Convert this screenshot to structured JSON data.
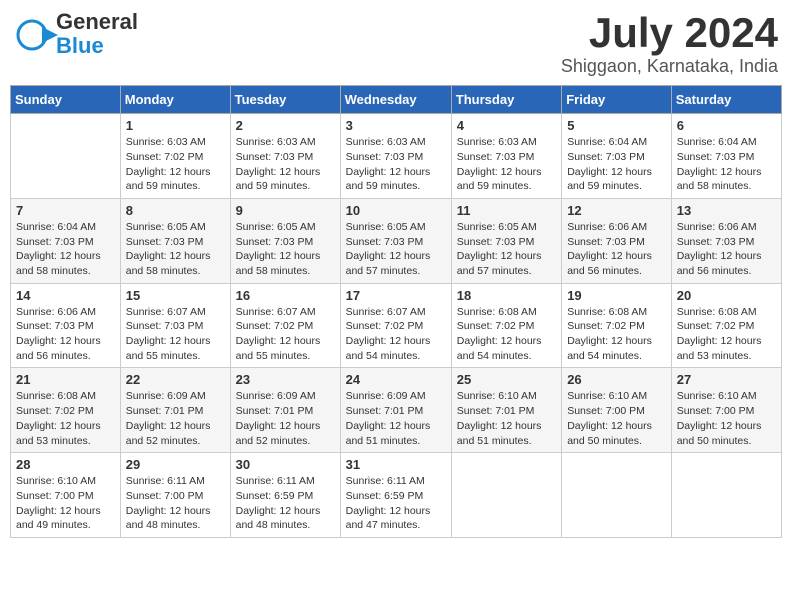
{
  "header": {
    "logo_line1": "General",
    "logo_line2": "Blue",
    "title": "July 2024",
    "subtitle": "Shiggaon, Karnataka, India"
  },
  "days_of_week": [
    "Sunday",
    "Monday",
    "Tuesday",
    "Wednesday",
    "Thursday",
    "Friday",
    "Saturday"
  ],
  "weeks": [
    [
      {
        "num": "",
        "info": ""
      },
      {
        "num": "1",
        "info": "Sunrise: 6:03 AM\nSunset: 7:02 PM\nDaylight: 12 hours\nand 59 minutes."
      },
      {
        "num": "2",
        "info": "Sunrise: 6:03 AM\nSunset: 7:03 PM\nDaylight: 12 hours\nand 59 minutes."
      },
      {
        "num": "3",
        "info": "Sunrise: 6:03 AM\nSunset: 7:03 PM\nDaylight: 12 hours\nand 59 minutes."
      },
      {
        "num": "4",
        "info": "Sunrise: 6:03 AM\nSunset: 7:03 PM\nDaylight: 12 hours\nand 59 minutes."
      },
      {
        "num": "5",
        "info": "Sunrise: 6:04 AM\nSunset: 7:03 PM\nDaylight: 12 hours\nand 59 minutes."
      },
      {
        "num": "6",
        "info": "Sunrise: 6:04 AM\nSunset: 7:03 PM\nDaylight: 12 hours\nand 58 minutes."
      }
    ],
    [
      {
        "num": "7",
        "info": "Sunrise: 6:04 AM\nSunset: 7:03 PM\nDaylight: 12 hours\nand 58 minutes."
      },
      {
        "num": "8",
        "info": "Sunrise: 6:05 AM\nSunset: 7:03 PM\nDaylight: 12 hours\nand 58 minutes."
      },
      {
        "num": "9",
        "info": "Sunrise: 6:05 AM\nSunset: 7:03 PM\nDaylight: 12 hours\nand 58 minutes."
      },
      {
        "num": "10",
        "info": "Sunrise: 6:05 AM\nSunset: 7:03 PM\nDaylight: 12 hours\nand 57 minutes."
      },
      {
        "num": "11",
        "info": "Sunrise: 6:05 AM\nSunset: 7:03 PM\nDaylight: 12 hours\nand 57 minutes."
      },
      {
        "num": "12",
        "info": "Sunrise: 6:06 AM\nSunset: 7:03 PM\nDaylight: 12 hours\nand 56 minutes."
      },
      {
        "num": "13",
        "info": "Sunrise: 6:06 AM\nSunset: 7:03 PM\nDaylight: 12 hours\nand 56 minutes."
      }
    ],
    [
      {
        "num": "14",
        "info": "Sunrise: 6:06 AM\nSunset: 7:03 PM\nDaylight: 12 hours\nand 56 minutes."
      },
      {
        "num": "15",
        "info": "Sunrise: 6:07 AM\nSunset: 7:03 PM\nDaylight: 12 hours\nand 55 minutes."
      },
      {
        "num": "16",
        "info": "Sunrise: 6:07 AM\nSunset: 7:02 PM\nDaylight: 12 hours\nand 55 minutes."
      },
      {
        "num": "17",
        "info": "Sunrise: 6:07 AM\nSunset: 7:02 PM\nDaylight: 12 hours\nand 54 minutes."
      },
      {
        "num": "18",
        "info": "Sunrise: 6:08 AM\nSunset: 7:02 PM\nDaylight: 12 hours\nand 54 minutes."
      },
      {
        "num": "19",
        "info": "Sunrise: 6:08 AM\nSunset: 7:02 PM\nDaylight: 12 hours\nand 54 minutes."
      },
      {
        "num": "20",
        "info": "Sunrise: 6:08 AM\nSunset: 7:02 PM\nDaylight: 12 hours\nand 53 minutes."
      }
    ],
    [
      {
        "num": "21",
        "info": "Sunrise: 6:08 AM\nSunset: 7:02 PM\nDaylight: 12 hours\nand 53 minutes."
      },
      {
        "num": "22",
        "info": "Sunrise: 6:09 AM\nSunset: 7:01 PM\nDaylight: 12 hours\nand 52 minutes."
      },
      {
        "num": "23",
        "info": "Sunrise: 6:09 AM\nSunset: 7:01 PM\nDaylight: 12 hours\nand 52 minutes."
      },
      {
        "num": "24",
        "info": "Sunrise: 6:09 AM\nSunset: 7:01 PM\nDaylight: 12 hours\nand 51 minutes."
      },
      {
        "num": "25",
        "info": "Sunrise: 6:10 AM\nSunset: 7:01 PM\nDaylight: 12 hours\nand 51 minutes."
      },
      {
        "num": "26",
        "info": "Sunrise: 6:10 AM\nSunset: 7:00 PM\nDaylight: 12 hours\nand 50 minutes."
      },
      {
        "num": "27",
        "info": "Sunrise: 6:10 AM\nSunset: 7:00 PM\nDaylight: 12 hours\nand 50 minutes."
      }
    ],
    [
      {
        "num": "28",
        "info": "Sunrise: 6:10 AM\nSunset: 7:00 PM\nDaylight: 12 hours\nand 49 minutes."
      },
      {
        "num": "29",
        "info": "Sunrise: 6:11 AM\nSunset: 7:00 PM\nDaylight: 12 hours\nand 48 minutes."
      },
      {
        "num": "30",
        "info": "Sunrise: 6:11 AM\nSunset: 6:59 PM\nDaylight: 12 hours\nand 48 minutes."
      },
      {
        "num": "31",
        "info": "Sunrise: 6:11 AM\nSunset: 6:59 PM\nDaylight: 12 hours\nand 47 minutes."
      },
      {
        "num": "",
        "info": ""
      },
      {
        "num": "",
        "info": ""
      },
      {
        "num": "",
        "info": ""
      }
    ]
  ]
}
